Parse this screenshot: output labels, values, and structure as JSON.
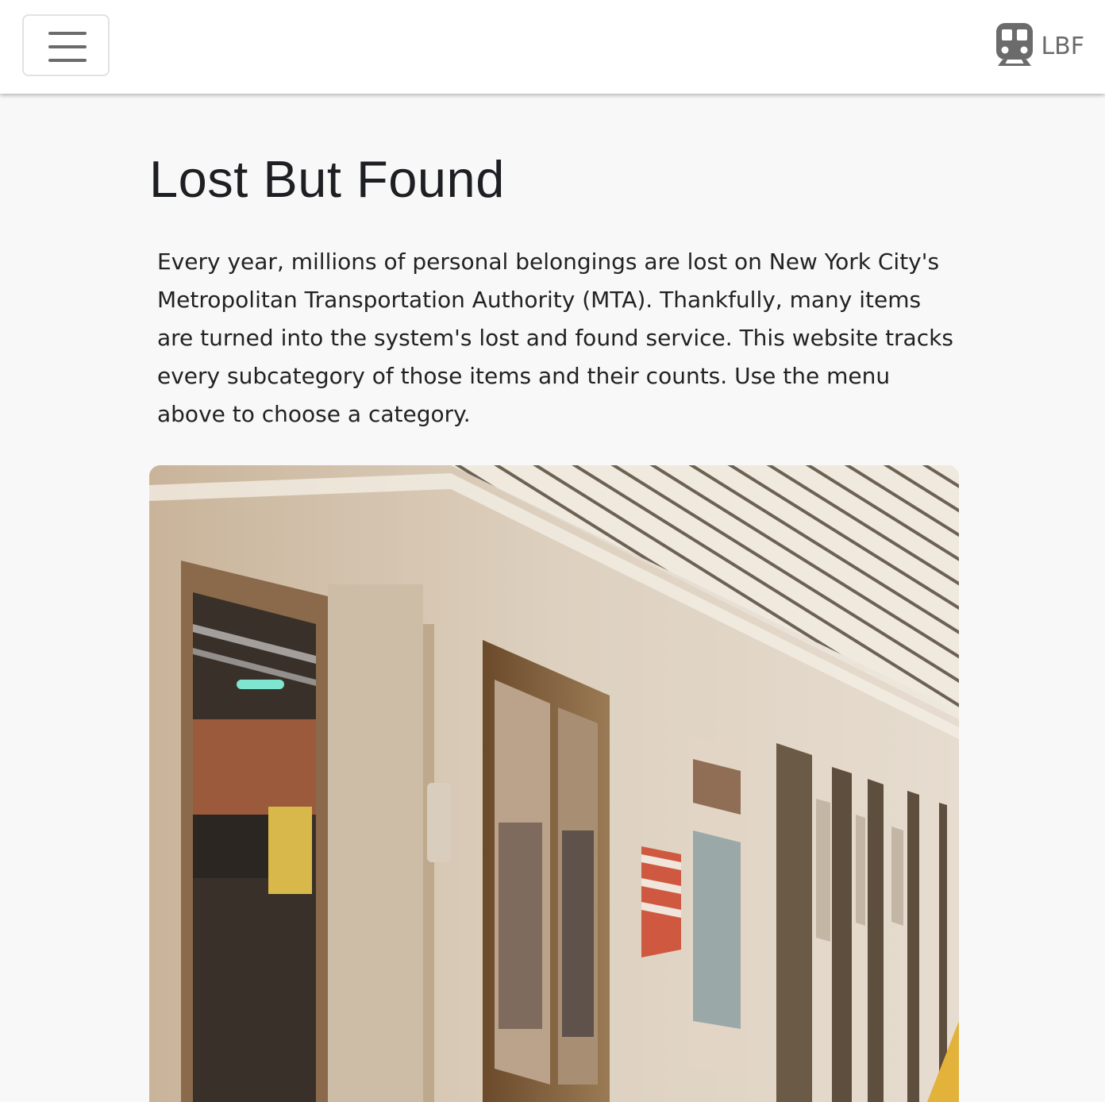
{
  "navbar": {
    "menu_button_icon": "hamburger-icon",
    "brand_icon": "subway-train-icon",
    "brand_text": "LBF"
  },
  "main": {
    "title": "Lost But Found",
    "intro": "Every year, millions of personal belongings are lost on New York City's Metropolitan Transportation Authority (MTA). Thankfully, many items are turned into the system's lost and found service. This website tracks every subcategory of those items and their counts. Use the menu above to choose a category.",
    "hero_image": "subway-train-photo"
  },
  "colors": {
    "page_background": "#f8f8f8",
    "navbar_background": "#ffffff",
    "icon_gray": "#6b6b6b",
    "text": "#212529"
  }
}
